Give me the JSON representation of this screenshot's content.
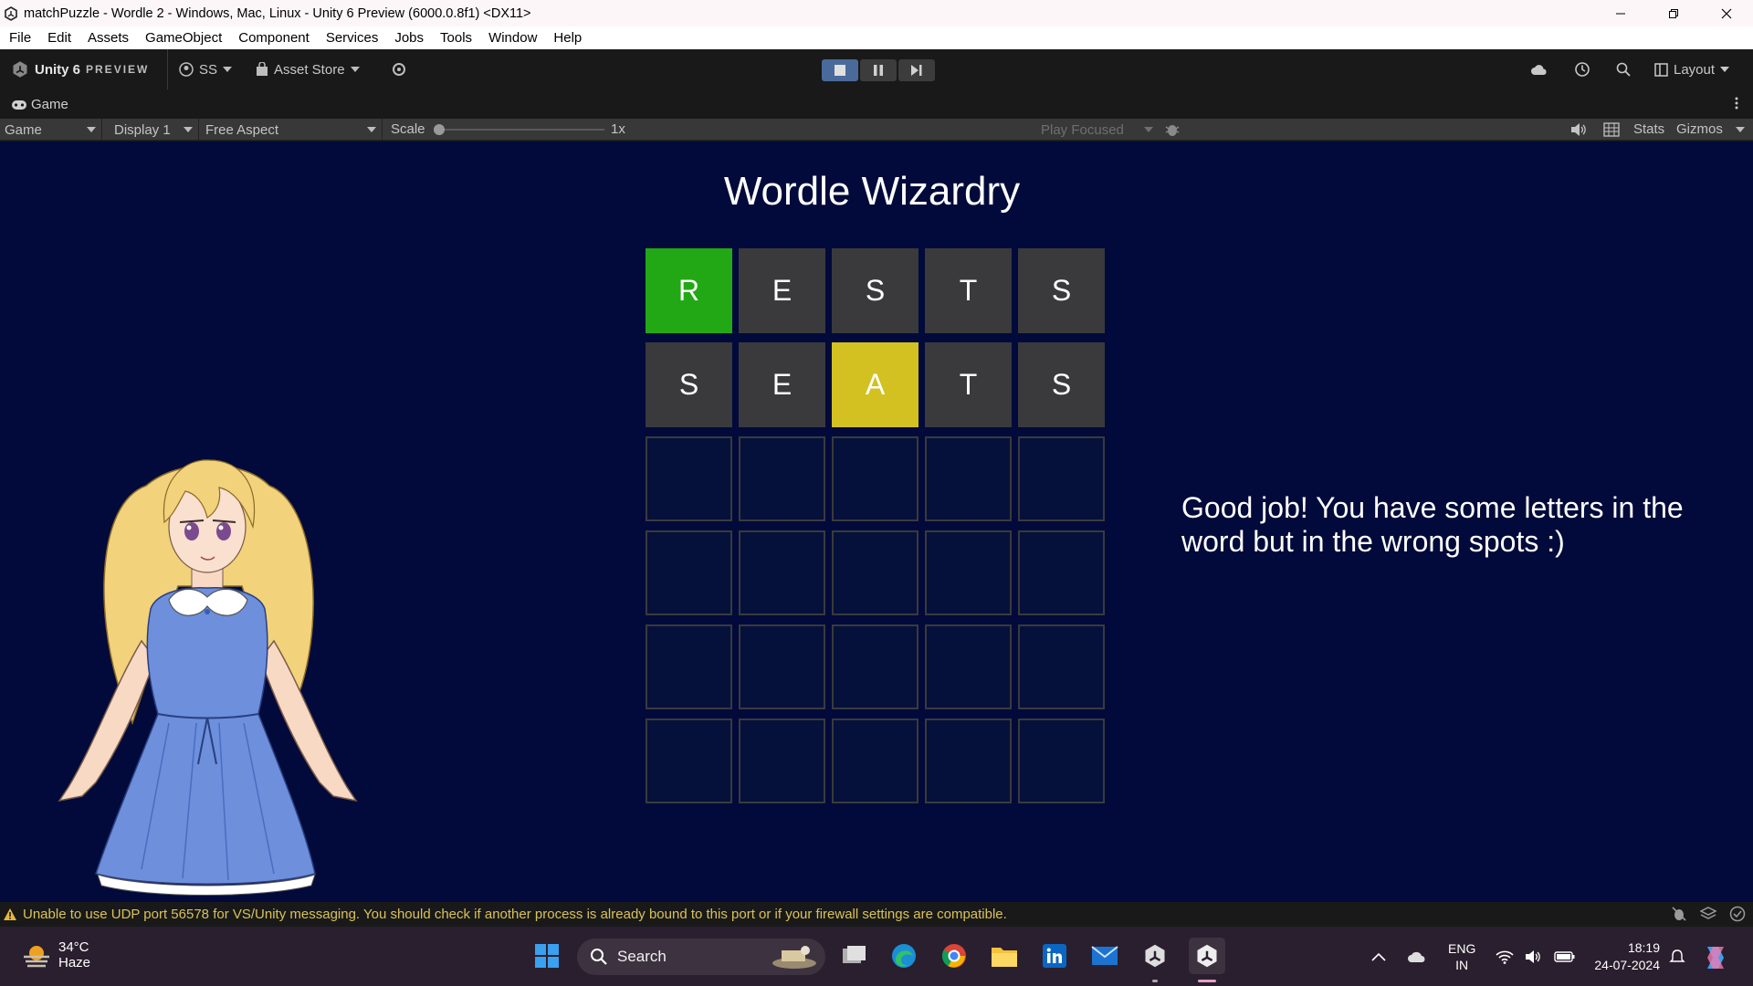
{
  "window": {
    "title": "matchPuzzle - Wordle 2 - Windows, Mac, Linux - Unity 6 Preview (6000.0.8f1) <DX11>"
  },
  "menu": [
    "File",
    "Edit",
    "Assets",
    "GameObject",
    "Component",
    "Services",
    "Jobs",
    "Tools",
    "Window",
    "Help"
  ],
  "toolbar": {
    "unity_label": "Unity 6",
    "preview_label": "PREVIEW",
    "account": "SS",
    "asset_store": "Asset Store",
    "layout": "Layout"
  },
  "tab": {
    "label": "Game"
  },
  "game_toolbar": {
    "view": "Game",
    "display": "Display 1",
    "aspect": "Free Aspect",
    "scale_label": "Scale",
    "scale_value": "1x",
    "play_mode": "Play Focused",
    "stats": "Stats",
    "gizmos": "Gizmos"
  },
  "game": {
    "title": "Wordle Wizardry",
    "rows": [
      [
        {
          "letter": "R",
          "state": "green"
        },
        {
          "letter": "E",
          "state": "filled"
        },
        {
          "letter": "S",
          "state": "filled"
        },
        {
          "letter": "T",
          "state": "filled"
        },
        {
          "letter": "S",
          "state": "filled"
        }
      ],
      [
        {
          "letter": "S",
          "state": "filled"
        },
        {
          "letter": "E",
          "state": "filled"
        },
        {
          "letter": "A",
          "state": "yellow"
        },
        {
          "letter": "T",
          "state": "filled"
        },
        {
          "letter": "S",
          "state": "filled"
        }
      ],
      [
        {
          "letter": "",
          "state": "empty"
        },
        {
          "letter": "",
          "state": "empty"
        },
        {
          "letter": "",
          "state": "empty"
        },
        {
          "letter": "",
          "state": "empty"
        },
        {
          "letter": "",
          "state": "empty"
        }
      ],
      [
        {
          "letter": "",
          "state": "empty"
        },
        {
          "letter": "",
          "state": "empty"
        },
        {
          "letter": "",
          "state": "empty"
        },
        {
          "letter": "",
          "state": "empty"
        },
        {
          "letter": "",
          "state": "empty"
        }
      ],
      [
        {
          "letter": "",
          "state": "empty"
        },
        {
          "letter": "",
          "state": "empty"
        },
        {
          "letter": "",
          "state": "empty"
        },
        {
          "letter": "",
          "state": "empty"
        },
        {
          "letter": "",
          "state": "empty"
        }
      ],
      [
        {
          "letter": "",
          "state": "empty"
        },
        {
          "letter": "",
          "state": "empty"
        },
        {
          "letter": "",
          "state": "empty"
        },
        {
          "letter": "",
          "state": "empty"
        },
        {
          "letter": "",
          "state": "empty"
        }
      ]
    ],
    "feedback": "Good job! You have some letters in the word but in the wrong spots :)",
    "colors": {
      "correct": "#22a815",
      "present": "#d2c120",
      "absent": "#3a3a3c",
      "background": "#010a3a"
    }
  },
  "status": {
    "message": "Unable to use UDP port 56578 for VS/Unity messaging. You should check if another process is already bound to this port or if your firewall settings are compatible."
  },
  "taskbar": {
    "weather_temp": "34°C",
    "weather_desc": "Haze",
    "search_placeholder": "Search",
    "lang_top": "ENG",
    "lang_bottom": "IN",
    "time": "18:19",
    "date": "24-07-2024",
    "apps": [
      "windows-start-icon",
      "task-view-icon",
      "edge-icon",
      "chrome-icon",
      "file-explorer-icon",
      "linkedin-icon",
      "mail-icon",
      "unity-hub-icon",
      "unity-editor-icon"
    ]
  }
}
